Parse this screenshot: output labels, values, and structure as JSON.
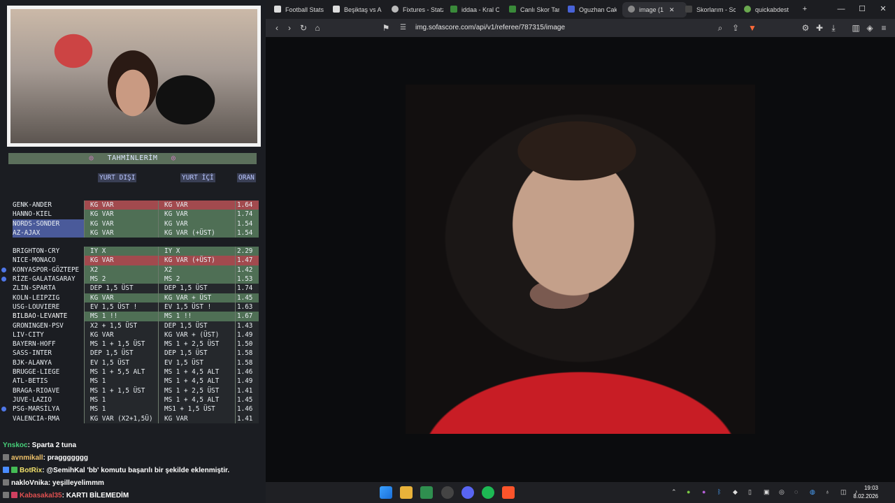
{
  "overlay": {
    "panel_title": "TAHMİNLERİM",
    "col_yurt_disi": "YURT DIŞI",
    "col_yurt_ici": "YURT İÇİ",
    "col_oran": "ORAN",
    "predictions_group1": [
      {
        "match": "GENK-ANDER",
        "a": "KG VAR",
        "b": "KG VAR",
        "odds": "1.64",
        "style": "red"
      },
      {
        "match": "HANNO-KIEL",
        "a": "KG VAR",
        "b": "KG VAR",
        "odds": "1.74",
        "style": "green"
      },
      {
        "match": "NORDS-SONDER",
        "a": "KG VAR",
        "b": "KG VAR",
        "odds": "1.54",
        "style": "green"
      },
      {
        "match": "AZ-AJAX",
        "a": "KG VAR",
        "b": "KG VAR (+ÜST)",
        "odds": "1.54",
        "style": "green"
      }
    ],
    "predictions_group2": [
      {
        "match": "BRIGHTON-CRY",
        "a": "IY X",
        "b": "IY X",
        "odds": "2.29",
        "style": "green"
      },
      {
        "match": "NICE-MONACO",
        "a": "KG VAR",
        "b": "KG VAR (+ÜST)",
        "odds": "1.47",
        "style": "red"
      },
      {
        "match": "KONYASPOR-GÖZTEPE",
        "a": "X2",
        "b": "X2",
        "odds": "1.42",
        "style": "green"
      },
      {
        "match": "RİZE-GALATASARAY",
        "a": "MS 2",
        "b": "MS 2",
        "odds": "1.53",
        "style": "green"
      },
      {
        "match": "ZLIN-SPARTA",
        "a": "DEP 1,5 ÜST",
        "b": "DEP 1,5 ÜST",
        "odds": "1.74",
        "style": "dark"
      },
      {
        "match": "KOLN-LEIPZIG",
        "a": "KG VAR",
        "b": "KG VAR + ÜST",
        "odds": "1.45",
        "style": "green"
      },
      {
        "match": "USG-LOUVIERE",
        "a": "EV 1,5 ÜST   !",
        "b": "EV 1,5 ÜST   !",
        "odds": "1.63",
        "style": "dark"
      },
      {
        "match": "BILBAO-LEVANTE",
        "a": "MS 1 !!",
        "b": "MS 1 !!",
        "odds": "1.67",
        "style": "green"
      },
      {
        "match": "GRONINGEN-PSV",
        "a": "X2 + 1,5 ÜST",
        "b": "DEP 1,5 ÜST",
        "odds": "1.43",
        "style": "dark"
      },
      {
        "match": "LIV-CITY",
        "a": "KG VAR",
        "b": "KG VAR + (ÜST)",
        "odds": "1.49",
        "style": "dark"
      },
      {
        "match": "BAYERN-HOFF",
        "a": "MS 1 + 1,5 ÜST",
        "b": "MS 1 + 2,5 ÜST",
        "odds": "1.50",
        "style": "dark"
      },
      {
        "match": "SASS-INTER",
        "a": "DEP 1,5 ÜST",
        "b": "DEP 1,5 ÜST",
        "odds": "1.58",
        "style": "dark"
      },
      {
        "match": "BJK-ALANYA",
        "a": "EV 1,5 ÜST",
        "b": "EV 1,5 ÜST",
        "odds": "1.58",
        "style": "dark"
      },
      {
        "match": "BRUGGE-LIEGE",
        "a": "MS 1 + 5,5 ALT",
        "b": "MS 1 + 4,5 ALT",
        "odds": "1.46",
        "style": "dark"
      },
      {
        "match": "ATL-BETIS",
        "a": "MS 1",
        "b": "MS 1 + 4,5 ALT",
        "odds": "1.49",
        "style": "dark"
      },
      {
        "match": "BRAGA-RIOAVE",
        "a": "MS 1 + 1,5 ÜST",
        "b": "MS 1 + 2,5 ÜST",
        "odds": "1.41",
        "style": "dark"
      },
      {
        "match": "JUVE-LAZIO",
        "a": "MS 1",
        "b": "MS 1 + 4,5 ALT",
        "odds": "1.45",
        "style": "dark"
      },
      {
        "match": "PSG-MARSİLYA",
        "a": "MS 1",
        "b": "MS1 + 1,5 ÜST",
        "odds": "1.46",
        "style": "dark"
      },
      {
        "match": "VALENCIA-RMA",
        "a": "KG VAR (X2+1,5Ü)",
        "b": "KG VAR",
        "odds": "1.41",
        "style": "dark"
      }
    ],
    "chat": [
      {
        "user": "Ynskoc",
        "text": ": Sparta 2 tuna",
        "color": "#47d17a"
      },
      {
        "user": "avnmikall",
        "text": ": praggggggg",
        "color": "#f0c36b"
      },
      {
        "user": "BotRix",
        "text": ": @SemihKal 'bb' komutu başarılı bir şekilde eklenmiştir.",
        "color": "#f0e06b"
      },
      {
        "user": "nakloVnika",
        "text": ": yeşilleyelimmm",
        "color": "#ffffff"
      },
      {
        "user": "Kabasakal35",
        "text": ": KARTI BİLEMEDİM",
        "color": "#e05050"
      }
    ]
  },
  "browser": {
    "tabs": [
      {
        "label": "Football Stats"
      },
      {
        "label": "Beşiktaş vs Ala"
      },
      {
        "label": "Fixtures - Statz"
      },
      {
        "label": "iddaa - Kral O"
      },
      {
        "label": "Canlı Skor Tara"
      },
      {
        "label": "Oguzhan Cak"
      },
      {
        "label": "image (1"
      },
      {
        "label": "Skorlarım - Sc"
      },
      {
        "label": "quickabdest"
      }
    ],
    "url": "img.sofascore.com/api/v1/referee/787315/image"
  },
  "taskbar": {
    "time": "19:03",
    "date": "8.02.2026"
  }
}
